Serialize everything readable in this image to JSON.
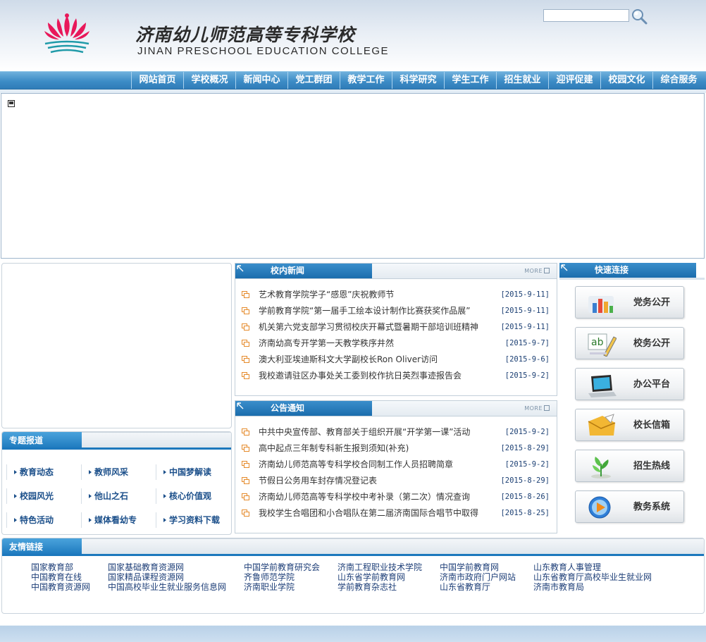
{
  "header": {
    "school_name_cn": "济南幼儿师范高等专科学校",
    "school_name_en": "JINAN PRESCHOOL EDUCATION COLLEGE",
    "search": {
      "value": "",
      "placeholder": ""
    },
    "search_icon": "magnifier-icon"
  },
  "nav": {
    "items": [
      "网站首页",
      "学校概况",
      "新闻中心",
      "党工群团",
      "教学工作",
      "科学研究",
      "学生工作",
      "招生就业",
      "迎评促建",
      "校园文化",
      "综合服务"
    ]
  },
  "special": {
    "title": "专题报道",
    "items": [
      "教育动态",
      "教师风采",
      "中国梦解读",
      "校园风光",
      "他山之石",
      "核心价值观",
      "特色活动",
      "媒体看幼专",
      "学习资料下载"
    ]
  },
  "news": {
    "title": "校内新闻",
    "more": "MORE",
    "items": [
      {
        "title": "艺术教育学院学子“感恩”庆祝教师节",
        "date": "[2015-9-11]"
      },
      {
        "title": "学前教育学院“第一届手工绘本设计制作比赛获奖作品展”",
        "date": "[2015-9-11]"
      },
      {
        "title": "机关第六党支部学习贯彻校庆开幕式暨暑期干部培训班精神",
        "date": "[2015-9-11]"
      },
      {
        "title": "济南幼高专开学第一天教学秩序井然",
        "date": "[2015-9-7]"
      },
      {
        "title": "澳大利亚埃迪斯科文大学副校长Ron Oliver访问",
        "date": "[2015-9-6]"
      },
      {
        "title": "我校邀请驻区办事处关工委到校作抗日英烈事迹报告会",
        "date": "[2015-9-2]"
      }
    ]
  },
  "notice": {
    "title": "公告通知",
    "more": "MORE",
    "items": [
      {
        "title": "中共中央宣传部、教育部关于组织开展“开学第一课”活动",
        "date": "[2015-9-2]"
      },
      {
        "title": "高中起点三年制专科新生报到须知(补充)",
        "date": "[2015-8-29]"
      },
      {
        "title": "济南幼儿师范高等专科学校合同制工作人员招聘简章",
        "date": "[2015-9-2]"
      },
      {
        "title": "节假日公务用车封存情况登记表",
        "date": "[2015-8-29]"
      },
      {
        "title": "济南幼儿师范高等专科学校中考补录（第二次）情况查询",
        "date": "[2015-8-26]"
      },
      {
        "title": "我校学生合唱团和小合唱队在第二届济南国际合唱节中取得",
        "date": "[2015-8-25]"
      }
    ]
  },
  "quick": {
    "title": "快速连接",
    "items": [
      {
        "label": "党务公开",
        "icon": "bar-chart-icon"
      },
      {
        "label": "校务公开",
        "icon": "ab-pencil-icon"
      },
      {
        "label": "办公平台",
        "icon": "laptop-icon"
      },
      {
        "label": "校长信箱",
        "icon": "envelope-icon"
      },
      {
        "label": "招生热线",
        "icon": "plant-icon"
      },
      {
        "label": "教务系统",
        "icon": "play-icon"
      }
    ]
  },
  "friends": {
    "title": "友情链接",
    "columns": [
      [
        "国家教育部",
        "中国教育在线",
        "中国教育资源网"
      ],
      [
        "国家基础教育资源网",
        "国家精品课程资源网",
        "中国高校毕业生就业服务信息网"
      ],
      [
        "中国学前教育研究会",
        "齐鲁师范学院",
        "济南职业学院"
      ],
      [
        "济南工程职业技术学院",
        "山东省学前教育网",
        "学前教育杂志社"
      ],
      [
        "中国学前教育网",
        "济南市政府门户网站",
        "山东省教育厅"
      ],
      [
        "山东教育人事管理",
        "山东省教育厅高校毕业生就业网",
        "济南市教育局"
      ]
    ]
  },
  "colors": {
    "nav": "#3d8cc6",
    "accent": "#1b6dad",
    "date": "#1b3f73",
    "logo": "#e8185a"
  }
}
